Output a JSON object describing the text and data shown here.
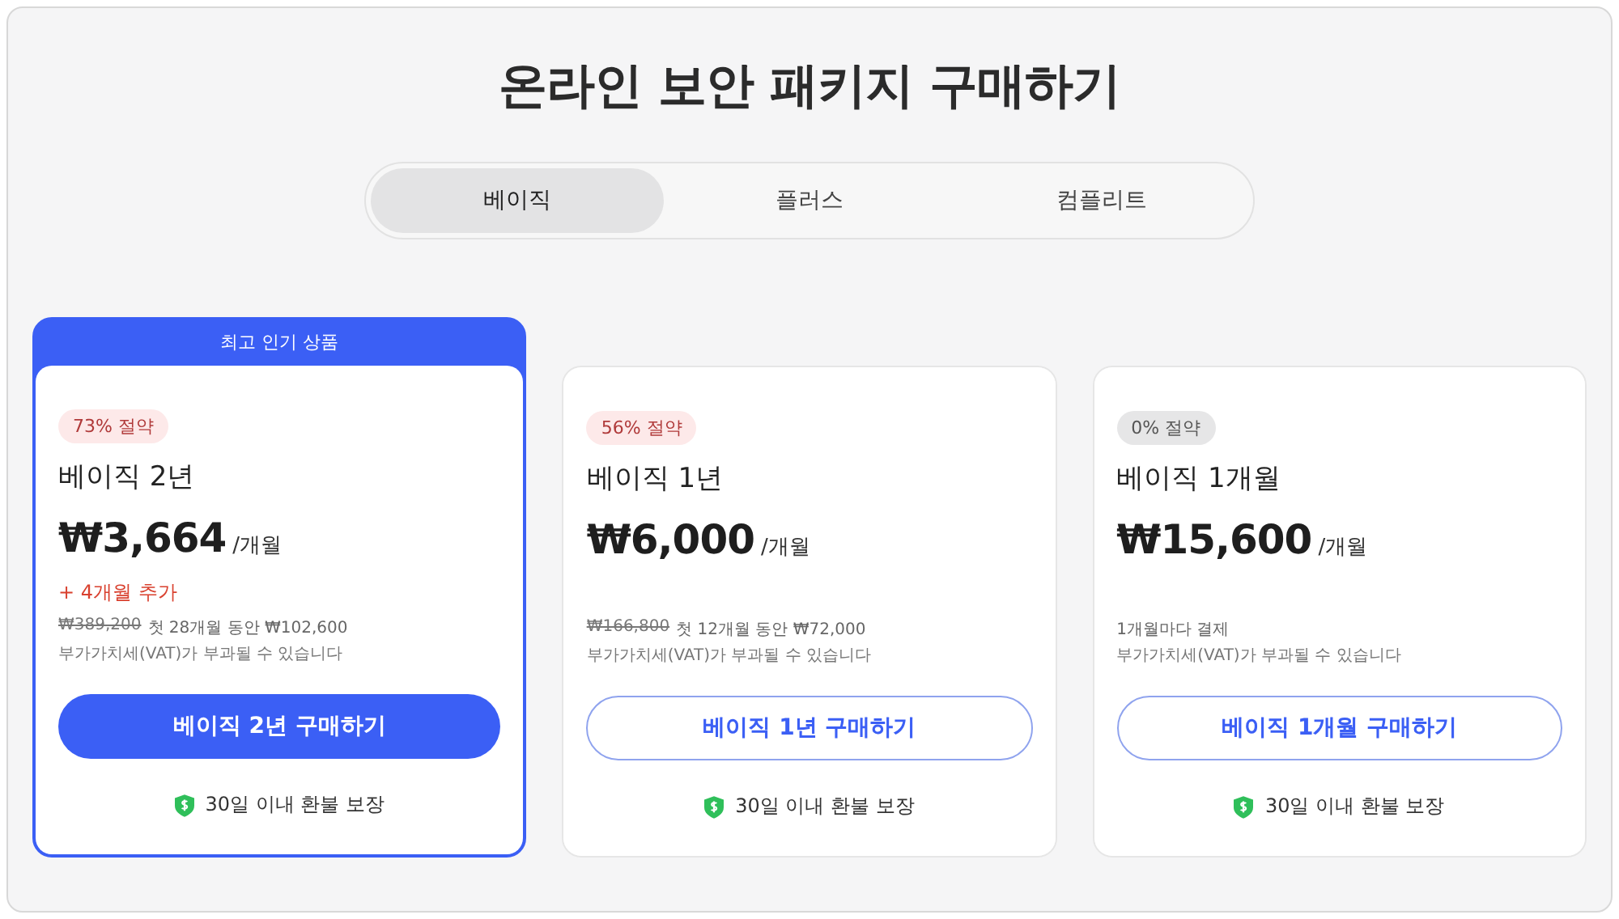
{
  "title": "온라인 보안 패키지 구매하기",
  "tabs": [
    {
      "label": "베이직",
      "selected": true
    },
    {
      "label": "플러스",
      "selected": false
    },
    {
      "label": "컴플리트",
      "selected": false
    }
  ],
  "plans": [
    {
      "featured": true,
      "banner": "최고 인기 상품",
      "badge": {
        "text": "73% 절약",
        "kind": "saving"
      },
      "name": "베이직 2년",
      "price": "₩3,664",
      "unit": "/개월",
      "bonus": "+ 4개월 추가",
      "old_price": "₩389,200",
      "note": "첫 28개월 동안 ₩102,600",
      "vat": "부가가치세(VAT)가 부과될 수 있습니다",
      "button": "베이직 2년 구매하기",
      "guarantee": "30일 이내 환불 보장"
    },
    {
      "featured": false,
      "badge": {
        "text": "56% 절약",
        "kind": "saving"
      },
      "name": "베이직 1년",
      "price": "₩6,000",
      "unit": "/개월",
      "old_price": "₩166,800",
      "note": "첫 12개월 동안 ₩72,000",
      "vat": "부가가치세(VAT)가 부과될 수 있습니다",
      "button": "베이직 1년 구매하기",
      "guarantee": "30일 이내 환불 보장"
    },
    {
      "featured": false,
      "badge": {
        "text": "0% 절약",
        "kind": "plain"
      },
      "name": "베이직 1개월",
      "price": "₩15,600",
      "unit": "/개월",
      "note": "1개월마다 결제",
      "vat": "부가가치세(VAT)가 부과될 수 있습니다",
      "button": "베이직 1개월 구매하기",
      "guarantee": "30일 이내 환불 보장"
    }
  ]
}
